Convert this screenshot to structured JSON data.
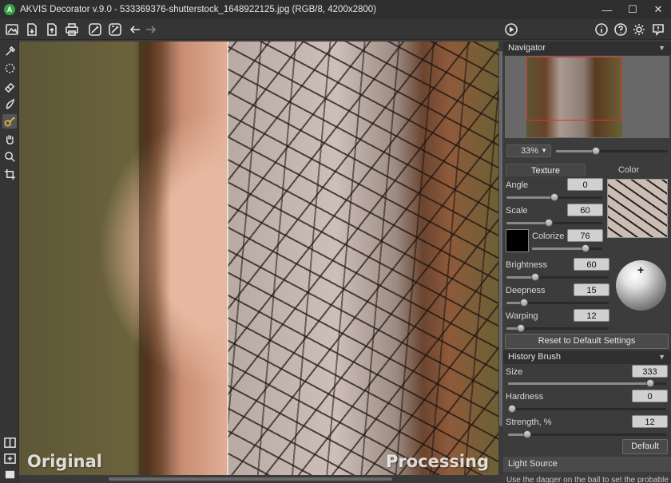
{
  "window": {
    "title": "AKVIS Decorator v.9.0 - 533369376-shutterstock_1648922125.jpg (RGB/8, 4200x2800)",
    "logo_letter": "A",
    "minimize_glyph": "—",
    "maximize_glyph": "☐",
    "close_glyph": "✕"
  },
  "toolbar": {
    "icons": [
      "open-icon",
      "save-icon",
      "save-as-icon",
      "print-icon",
      "brush-settings-icon",
      "history-brush-icon",
      "undo-icon",
      "redo-icon"
    ],
    "run_icon": "play-icon",
    "right_icons": [
      "info-icon",
      "help-icon",
      "settings-icon",
      "notification-icon"
    ]
  },
  "tools": [
    "selection-brush-icon",
    "lasso-icon",
    "eraser-icon",
    "history-brush-icon",
    "color-brush-icon",
    "hand-icon",
    "zoom-icon",
    "crop-icon"
  ],
  "canvas": {
    "label_original": "Original",
    "label_processing": "Processing"
  },
  "navigator": {
    "header": "Navigator",
    "zoom_value": "33%",
    "zoom_slider": 0.36
  },
  "tabs": {
    "texture": "Texture",
    "color": "Color"
  },
  "params": {
    "angle": {
      "label": "Angle",
      "value": "0",
      "level": 0.5
    },
    "scale": {
      "label": "Scale",
      "value": "60",
      "level": 0.44
    },
    "colorize": {
      "label": "Colorize",
      "value": "76",
      "level": 0.76
    },
    "brightness": {
      "label": "Brightness",
      "value": "60",
      "level": 0.28
    },
    "deepness": {
      "label": "Deepness",
      "value": "15",
      "level": 0.17
    },
    "warping": {
      "label": "Warping",
      "value": "12",
      "level": 0.14
    }
  },
  "buttons": {
    "reset": "Reset to Default Settings",
    "default": "Default"
  },
  "history_brush": {
    "header": "History Brush",
    "size": {
      "label": "Size",
      "value": "333",
      "level": 0.9
    },
    "hardness": {
      "label": "Hardness",
      "value": "0",
      "level": 0.0
    },
    "strength": {
      "label": "Strength, %",
      "value": "12",
      "level": 0.12
    }
  },
  "light_source": {
    "header": "Light Source",
    "text": "Use the dagger on the ball to set the probable"
  },
  "colors": {
    "accent_logo": "#3aa24a",
    "navigator_frame": "#dd3333"
  }
}
